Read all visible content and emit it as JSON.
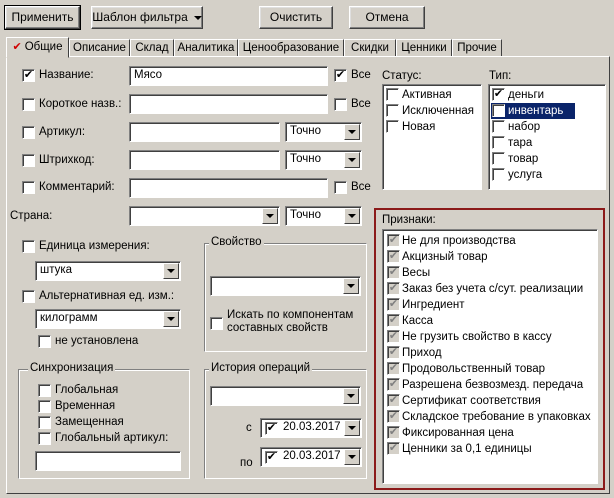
{
  "toolbar": {
    "apply_label": "Применить",
    "template_label": "Шаблон фильтра",
    "clear_label": "Очистить",
    "cancel_label": "Отмена"
  },
  "tabs": [
    {
      "label": "Общие",
      "active": true
    },
    {
      "label": "Описание"
    },
    {
      "label": "Склад"
    },
    {
      "label": "Аналитика"
    },
    {
      "label": "Ценообразование"
    },
    {
      "label": "Скидки"
    },
    {
      "label": "Ценники"
    },
    {
      "label": "Прочие"
    }
  ],
  "fields": {
    "name": {
      "label": "Название:",
      "checked": true,
      "value": "Мясо",
      "all_label": "Все",
      "all_checked": true
    },
    "short_name": {
      "label": "Короткое назв.:",
      "checked": false,
      "value": "",
      "all_label": "Все",
      "all_checked": false
    },
    "article": {
      "label": "Артикул:",
      "checked": false,
      "value": "",
      "mode": "Точно"
    },
    "barcode": {
      "label": "Штрихкод:",
      "checked": false,
      "value": "",
      "mode": "Точно"
    },
    "comment": {
      "label": "Комментарий:",
      "checked": false,
      "value": "",
      "all_label": "Все",
      "all_checked": false
    },
    "country": {
      "label": "Страна:",
      "value": "",
      "mode": "Точно"
    }
  },
  "unit": {
    "label": "Единица измерения:",
    "checked": false,
    "value": "штука"
  },
  "alt_unit": {
    "label": "Альтернативная ед. изм.:",
    "checked": false,
    "value": "килограмм",
    "not_set_label": "не установлена",
    "not_set_checked": false
  },
  "property": {
    "title": "Свойство",
    "value": "",
    "search_label_line1": "Искать по компонентам",
    "search_label_line2": "составных свойств",
    "search_checked": false
  },
  "sync": {
    "title": "Синхронизация",
    "items": [
      {
        "label": "Глобальная",
        "checked": false
      },
      {
        "label": "Временная",
        "checked": false
      },
      {
        "label": "Замещенная",
        "checked": false
      },
      {
        "label": "Глобальный артикул:",
        "checked": false
      }
    ],
    "article_value": ""
  },
  "history": {
    "title": "История операций",
    "value": "",
    "from_label": "с",
    "from_date": "20.03.2017",
    "to_label": "по",
    "to_date": "20.03.2017"
  },
  "status": {
    "label": "Статус:",
    "items": [
      {
        "label": "Активная",
        "checked": false
      },
      {
        "label": "Исключенная",
        "checked": false
      },
      {
        "label": "Новая",
        "checked": false
      }
    ]
  },
  "type": {
    "label": "Тип:",
    "items": [
      {
        "label": "деньги",
        "checked": true,
        "selected": false
      },
      {
        "label": "инвентарь",
        "checked": true,
        "selected": true
      },
      {
        "label": "набор",
        "checked": false
      },
      {
        "label": "тара",
        "checked": false
      },
      {
        "label": "товар",
        "checked": false
      },
      {
        "label": "услуга",
        "checked": false
      }
    ]
  },
  "attributes": {
    "label": "Признаки:",
    "items": [
      "Не для производства",
      "Акцизный товар",
      "Весы",
      "Заказ без учета с/сут. реализации",
      "Ингредиент",
      "Касса",
      "Не грузить свойство в кассу",
      "Приход",
      "Продовольственный товар",
      "Разрешена безвозмезд. передача",
      "Сертификат соответствия",
      "Складское требование в упаковках",
      "Фиксированная цена",
      "Ценники за 0,1 единицы"
    ]
  },
  "colors": {
    "highlight_border": "#8b1a1a",
    "selection": "#0a246a",
    "tab_check": "#d00000"
  }
}
